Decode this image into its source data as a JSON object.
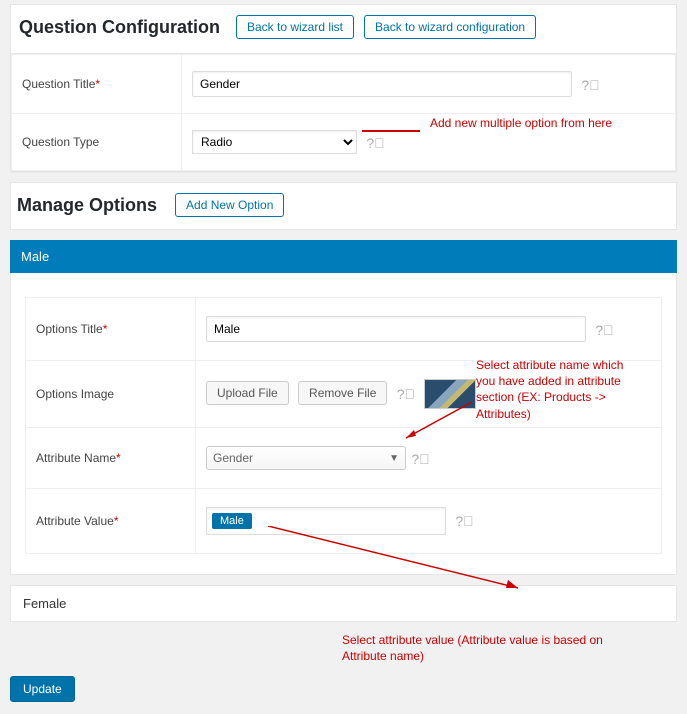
{
  "header": {
    "title": "Question Configuration",
    "back_list": "Back to wizard list",
    "back_config": "Back to wizard configuration"
  },
  "question": {
    "title_label": "Question Title",
    "title_value": "Gender",
    "type_label": "Question Type",
    "type_value": "Radio"
  },
  "annotations": {
    "add_option": "Add new multiple option from here",
    "attr_name_note": "Select attribute name which you have added in attribute section (EX: Products -> Attributes)",
    "attr_value_note": "Select attribute value (Attribute value is based on Attribute name)"
  },
  "options": {
    "heading": "Manage Options",
    "add_btn": "Add New Option",
    "acc1_title": "Male",
    "fields": {
      "title_label": "Options Title",
      "title_value": "Male",
      "image_label": "Options Image",
      "upload": "Upload File",
      "remove": "Remove File",
      "attr_name_label": "Attribute Name",
      "attr_name_value": "Gender",
      "attr_value_label": "Attribute Value",
      "attr_value_chip": "Male"
    },
    "acc2_title": "Female"
  },
  "footer": {
    "update": "Update"
  }
}
